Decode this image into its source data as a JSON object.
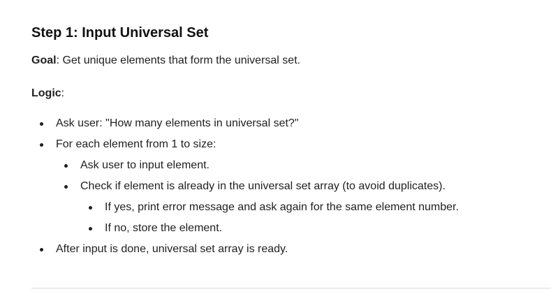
{
  "step": {
    "heading": "Step 1: Input Universal Set",
    "goal_label": "Goal",
    "goal_text": ": Get unique elements that form the universal set.",
    "logic_label": "Logic",
    "logic_suffix": ":"
  },
  "items": [
    {
      "text": "Ask user: \"How many elements in universal set?\""
    },
    {
      "text": "For each element from 1 to size:"
    },
    {
      "text": "Ask user to input element."
    },
    {
      "text": "Check if element is already in the universal set array (to avoid duplicates)."
    },
    {
      "text": "If yes, print error message and ask again for the same element number."
    },
    {
      "text": "If no, store the element."
    },
    {
      "text": "After input is done, universal set array is ready."
    }
  ]
}
